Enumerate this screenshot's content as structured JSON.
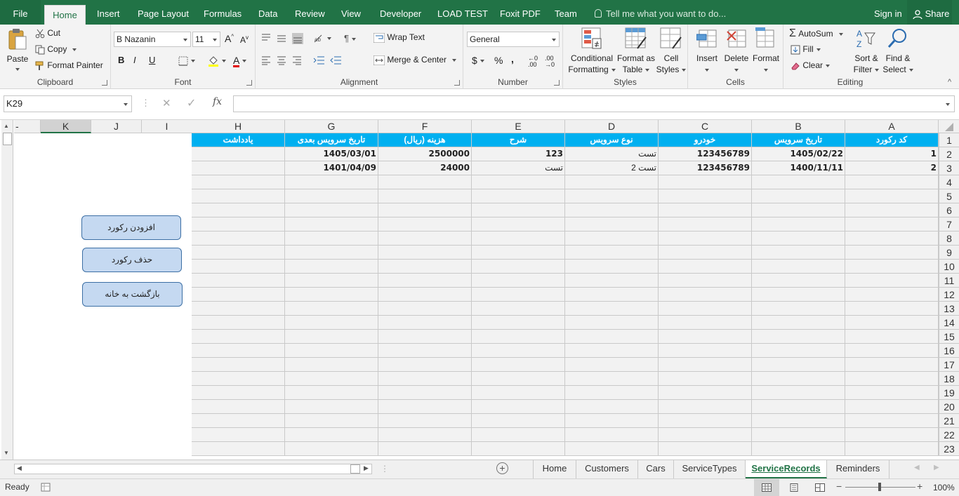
{
  "ribbon_tabs": [
    "File",
    "Home",
    "Insert",
    "Page Layout",
    "Formulas",
    "Data",
    "Review",
    "View",
    "Developer",
    "LOAD TEST",
    "Foxit PDF",
    "Team"
  ],
  "tell_me": "Tell me what you want to do...",
  "sign_in": "Sign in",
  "share": "Share",
  "clipboard": {
    "paste": "Paste",
    "cut": "Cut",
    "copy": "Copy",
    "format_painter": "Format Painter",
    "label": "Clipboard"
  },
  "font": {
    "name": "B Nazanin",
    "size": "11",
    "label": "Font",
    "bold": "B",
    "italic": "I",
    "underline": "U"
  },
  "alignment": {
    "wrap_text": "Wrap Text",
    "merge_center": "Merge & Center",
    "label": "Alignment"
  },
  "number": {
    "format": "General",
    "currency": "$",
    "percent": "%",
    "comma": ",",
    "label": "Number"
  },
  "styles": {
    "conditional": [
      "Conditional",
      "Formatting"
    ],
    "format_table": [
      "Format as",
      "Table"
    ],
    "cell_styles": [
      "Cell",
      "Styles"
    ],
    "label": "Styles"
  },
  "cells": {
    "insert": "Insert",
    "delete": "Delete",
    "format": "Format",
    "label": "Cells"
  },
  "editing": {
    "autosum": "AutoSum",
    "fill": "Fill",
    "clear": "Clear",
    "sort": [
      "Sort &",
      "Filter"
    ],
    "find": [
      "Find &",
      "Select"
    ],
    "label": "Editing"
  },
  "name_box": "K29",
  "formula_fx": "fx",
  "formula_value": "",
  "columns": [
    "A",
    "B",
    "C",
    "D",
    "E",
    "F",
    "G",
    "H",
    "I",
    "J",
    "K"
  ],
  "header_row": [
    "کد رکورد",
    "تاریخ سرویس",
    "خودرو",
    "نوع سرویس",
    "شرح",
    "هزینه (ریال)",
    "تاریخ سرویس بعدی",
    "یادداشت"
  ],
  "rows": [
    [
      "1",
      "1405/02/22",
      "123456789",
      "تست",
      "123",
      "2500000",
      "1405/03/01",
      ""
    ],
    [
      "2",
      "1400/11/11",
      "123456789",
      "تست 2",
      "تست",
      "24000",
      "1401/04/09",
      ""
    ]
  ],
  "row_numbers": [
    "1",
    "2",
    "3",
    "4",
    "5",
    "6",
    "7",
    "8",
    "9",
    "10",
    "11",
    "12",
    "13",
    "14",
    "15",
    "16",
    "17",
    "18",
    "19",
    "20",
    "21",
    "22",
    "23"
  ],
  "buttons": {
    "add": "افزودن رکورد",
    "delete": "حذف رکورد",
    "home": "بازگشت به خانه"
  },
  "sheet_tabs": [
    "Home",
    "Customers",
    "Cars",
    "ServiceTypes",
    "ServiceRecords",
    "Reminders"
  ],
  "active_sheet": "ServiceRecords",
  "status": {
    "ready": "Ready",
    "zoom": "100%"
  },
  "colors": {
    "brand": "#217346",
    "header_fill": "#00b0f0",
    "button_fill": "#c5d9f1"
  }
}
